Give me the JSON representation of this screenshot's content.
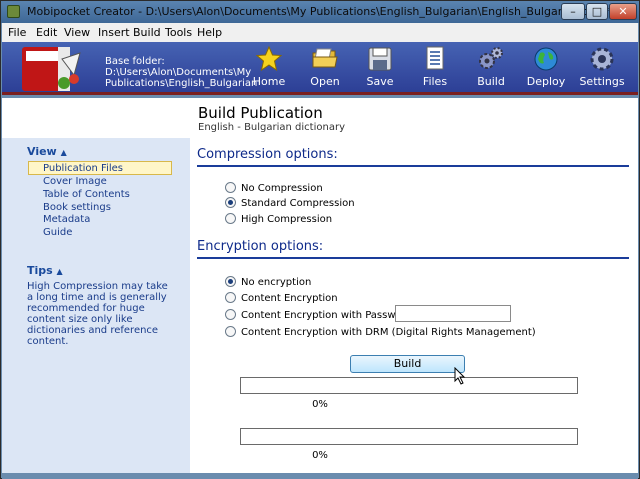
{
  "window": {
    "title": "Mobipocket Creator - D:\\Users\\Alon\\Documents\\My Publications\\English_Bulgarian\\English_Bulgarian.opf *"
  },
  "menu": [
    "File",
    "Edit",
    "View",
    "Insert",
    "Build",
    "Tools",
    "Help"
  ],
  "toolbar": {
    "base_label": "Base folder:",
    "base_path_1": "D:\\Users\\Alon\\Documents\\My",
    "base_path_2": "Publications\\English_Bulgarian",
    "buttons": [
      {
        "label": "Home",
        "icon": "star-icon"
      },
      {
        "label": "Open",
        "icon": "folder-open-icon"
      },
      {
        "label": "Save",
        "icon": "floppy-disk-icon"
      },
      {
        "label": "Files",
        "icon": "files-icon"
      },
      {
        "label": "Build",
        "icon": "gears-icon"
      },
      {
        "label": "Deploy",
        "icon": "globe-icon"
      },
      {
        "label": "Settings",
        "icon": "settings-gear-icon"
      }
    ]
  },
  "header": {
    "title": "Build Publication",
    "subtitle": "English - Bulgarian dictionary"
  },
  "sidebar": {
    "view_title": "View",
    "items": [
      "Publication Files",
      "Cover Image",
      "Table of Contents",
      "Book settings",
      "Metadata",
      "Guide"
    ],
    "tips_title": "Tips",
    "tips_text": "High Compression may take a long time and is generally recommended for huge content size only like dictionaries and reference content."
  },
  "compression": {
    "title": "Compression options:",
    "options": [
      "No Compression",
      "Standard Compression",
      "High Compression"
    ],
    "selected": "Standard Compression"
  },
  "encryption": {
    "title": "Encryption options:",
    "options": [
      "No encryption",
      "Content Encryption",
      "Content Encryption with Password :",
      "Content Encryption with DRM (Digital Rights Management)"
    ],
    "selected": "No encryption",
    "password_value": ""
  },
  "build_button": "Build",
  "progress": [
    {
      "percent_text": "0%",
      "value": 0
    },
    {
      "percent_text": "0%",
      "value": 0
    }
  ],
  "colors": {
    "toolbar": "#2d3f96",
    "accent": "#0e2a8a",
    "sidebar": "#dce6f5"
  }
}
